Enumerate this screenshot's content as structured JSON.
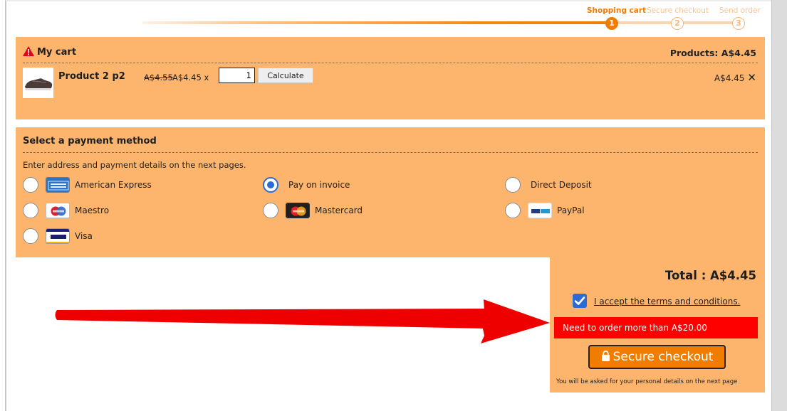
{
  "progress": {
    "steps": [
      {
        "label": "Shopping cart",
        "number": "1",
        "active": true
      },
      {
        "label": "Secure checkout",
        "number": "2",
        "active": false
      },
      {
        "label": "Send order",
        "number": "3",
        "active": false
      }
    ]
  },
  "cart": {
    "title": "My cart",
    "products_total": "Products: A$4.45",
    "item": {
      "name": "Product 2  p2",
      "old_price": "A$4.55",
      "price_each": "A$4.45 x",
      "quantity": "1",
      "calculate_label": "Calculate",
      "line_total": "A$4.45",
      "remove_icon": "close-icon"
    }
  },
  "payment": {
    "title": "Select a payment method",
    "intro": "Enter address and payment details on the next pages.",
    "options": [
      {
        "label": "American Express",
        "icon": "amex-card-icon",
        "selected": false
      },
      {
        "label": "Pay on invoice",
        "icon": "",
        "selected": true
      },
      {
        "label": "Direct Deposit",
        "icon": "",
        "selected": false
      },
      {
        "label": "Maestro",
        "icon": "maestro-card-icon",
        "selected": false
      },
      {
        "label": "Mastercard",
        "icon": "mastercard-icon",
        "selected": false
      },
      {
        "label": "PayPal",
        "icon": "paypal-icon",
        "selected": false
      },
      {
        "label": "Visa",
        "icon": "visa-card-icon",
        "selected": false
      }
    ]
  },
  "summary": {
    "total": "Total :  A$4.45",
    "terms_label": "I accept the terms and conditions.",
    "terms_checked": true,
    "min_order_warning": "Need to order more than  A$20.00",
    "checkout_label": "Secure checkout",
    "note": "You will be asked for your personal details on the next page"
  },
  "colors": {
    "accent": "#f07d00",
    "panel": "#fdb56e",
    "warning": "#ff0000",
    "radio_selected": "#2c6bd6"
  }
}
